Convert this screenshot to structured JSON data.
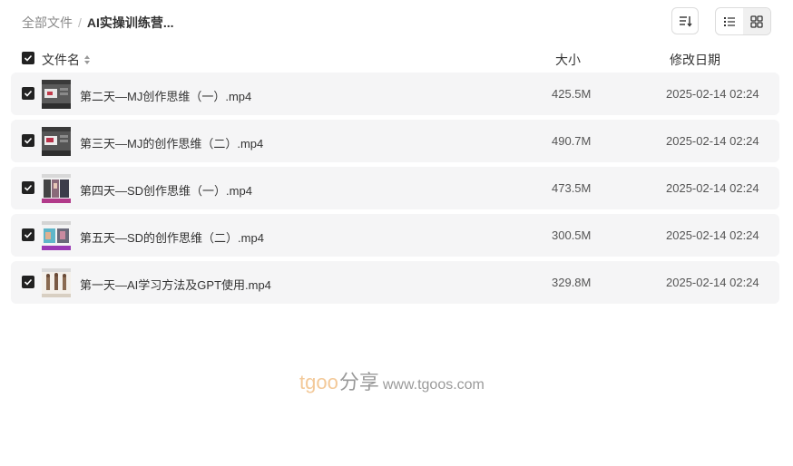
{
  "breadcrumb": {
    "root": "全部文件",
    "separator": "/",
    "current": "AI实操训练营..."
  },
  "toolbar": {
    "sort_icon": "sort-icon",
    "list_view_icon": "list-view-icon",
    "grid_view_icon": "grid-view-icon"
  },
  "table_header": {
    "name": "文件名",
    "size": "大小",
    "date": "修改日期"
  },
  "files": [
    {
      "name": "第二天—MJ创作思维（一）.mp4",
      "size": "425.5M",
      "date": "2025-02-14 02:24",
      "checked": true
    },
    {
      "name": "第三天—MJ的创作思维（二）.mp4",
      "size": "490.7M",
      "date": "2025-02-14 02:24",
      "checked": true
    },
    {
      "name": "第四天—SD创作思维（一）.mp4",
      "size": "473.5M",
      "date": "2025-02-14 02:24",
      "checked": true
    },
    {
      "name": "第五天—SD的创作思维（二）.mp4",
      "size": "300.5M",
      "date": "2025-02-14 02:24",
      "checked": true
    },
    {
      "name": "第一天—AI学习方法及GPT使用.mp4",
      "size": "329.8M",
      "date": "2025-02-14 02:24",
      "checked": true
    }
  ],
  "watermark": {
    "brand": "tgoo",
    "suffix": "分享",
    "site": "www.tgoos.com"
  },
  "colors": {
    "row_bg": "#f5f5f6",
    "checkbox": "#222222",
    "watermark_accent": "#f3c999"
  }
}
